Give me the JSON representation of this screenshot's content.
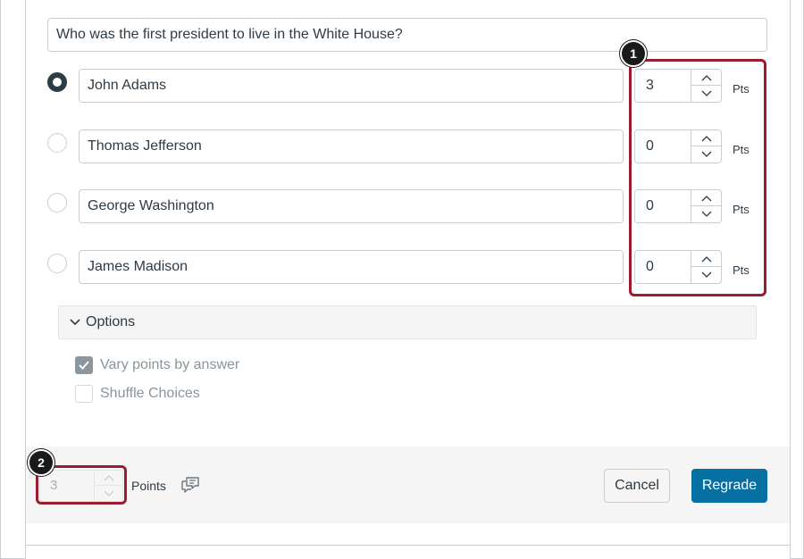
{
  "question": {
    "text": "Who was the first president to live in the White House?"
  },
  "answers": [
    {
      "text": "John Adams",
      "points": "3",
      "correct": true
    },
    {
      "text": "Thomas Jefferson",
      "points": "0",
      "correct": false
    },
    {
      "text": "George Washington",
      "points": "0",
      "correct": false
    },
    {
      "text": "James Madison",
      "points": "0",
      "correct": false
    }
  ],
  "pts_label": "Pts",
  "callouts": {
    "one": "1",
    "two": "2"
  },
  "options": {
    "label": "Options",
    "vary_points": {
      "label": "Vary points by answer",
      "checked": true
    },
    "shuffle": {
      "label": "Shuffle Choices",
      "checked": false
    }
  },
  "footer": {
    "points_value": "3",
    "points_label": "Points",
    "cancel_label": "Cancel",
    "regrade_label": "Regrade"
  },
  "colors": {
    "callout_border": "#9b1b2f",
    "primary_button": "#0770a3",
    "text": "#2d3b45"
  }
}
